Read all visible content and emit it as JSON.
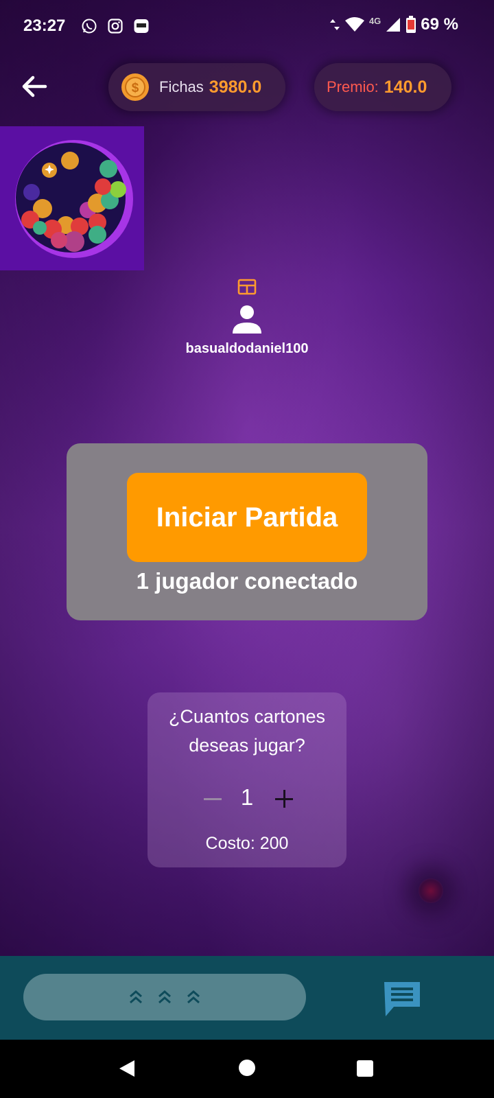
{
  "status_bar": {
    "time": "23:27",
    "network": "4G",
    "battery": "69 %"
  },
  "top_bar": {
    "fichas_label": "Fichas",
    "fichas_value": "3980.0",
    "premio_label": "Premio:",
    "premio_value": "140.0"
  },
  "user": {
    "username": "basualdodaniel100"
  },
  "start_panel": {
    "button_label": "Iniciar Partida",
    "connected_text": "1 jugador conectado"
  },
  "cartones": {
    "question_line1": "¿Cuantos cartones",
    "question_line2": "deseas jugar?",
    "quantity": "1",
    "cost_text": "Costo: 200"
  },
  "colors": {
    "accent_orange": "#ff9a00",
    "value_orange": "#ff9b2e",
    "premio_red": "#ff5a4f",
    "bottom_panel": "#0e4b5a"
  },
  "icons": [
    "back-arrow-icon",
    "coin-icon",
    "card-icon",
    "user-icon",
    "chevron-up-icon",
    "chat-icon"
  ]
}
